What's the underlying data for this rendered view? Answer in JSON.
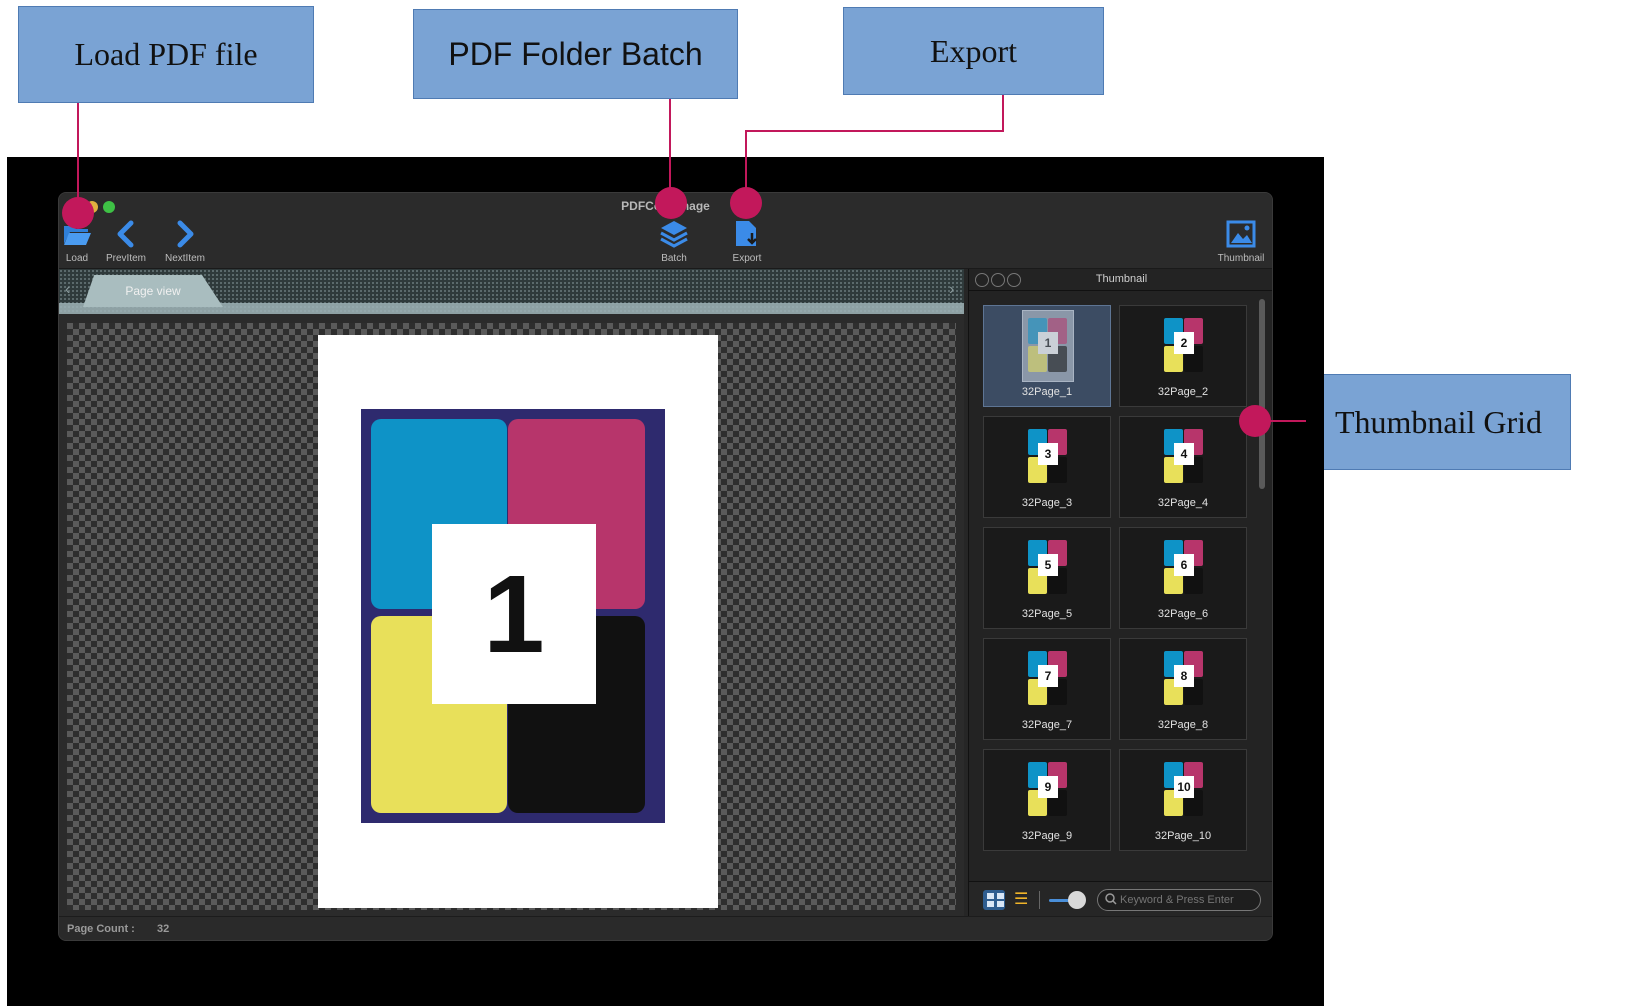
{
  "callouts": {
    "load": "Load PDF file",
    "batch": "PDF Folder Batch",
    "export": "Export",
    "thumbnail_grid": "Thumbnail Grid"
  },
  "window": {
    "title": "PDFConvImage"
  },
  "toolbar": {
    "load": "Load",
    "prev": "PrevItem",
    "next": "NextItem",
    "batch": "Batch",
    "export": "Export",
    "thumbnail": "Thumbnail"
  },
  "page_view": {
    "tab_label": "Page view",
    "page_number": "1"
  },
  "status": {
    "page_count_label": "Page Count :",
    "page_count_value": "32"
  },
  "thumbnail_panel": {
    "title": "Thumbnail",
    "items": [
      {
        "num": "1",
        "label": "32Page_1"
      },
      {
        "num": "2",
        "label": "32Page_2"
      },
      {
        "num": "3",
        "label": "32Page_3"
      },
      {
        "num": "4",
        "label": "32Page_4"
      },
      {
        "num": "5",
        "label": "32Page_5"
      },
      {
        "num": "6",
        "label": "32Page_6"
      },
      {
        "num": "7",
        "label": "32Page_7"
      },
      {
        "num": "8",
        "label": "32Page_8"
      },
      {
        "num": "9",
        "label": "32Page_9"
      },
      {
        "num": "10",
        "label": "32Page_10"
      }
    ],
    "search_placeholder": "Keyword & Press Enter"
  },
  "colors": {
    "accent": "#3b82d6",
    "callout_fill": "#7aa3d4",
    "leader": "#c2185b",
    "cyan": "#0e93c7",
    "magenta": "#b7356b",
    "yellow": "#e8e05a",
    "black": "#111111"
  },
  "icons": [
    "folder-open-icon",
    "chevron-left-icon",
    "chevron-right-icon",
    "layers-icon",
    "document-download-icon",
    "image-icon",
    "grid-view-icon",
    "list-view-icon",
    "search-icon"
  ]
}
